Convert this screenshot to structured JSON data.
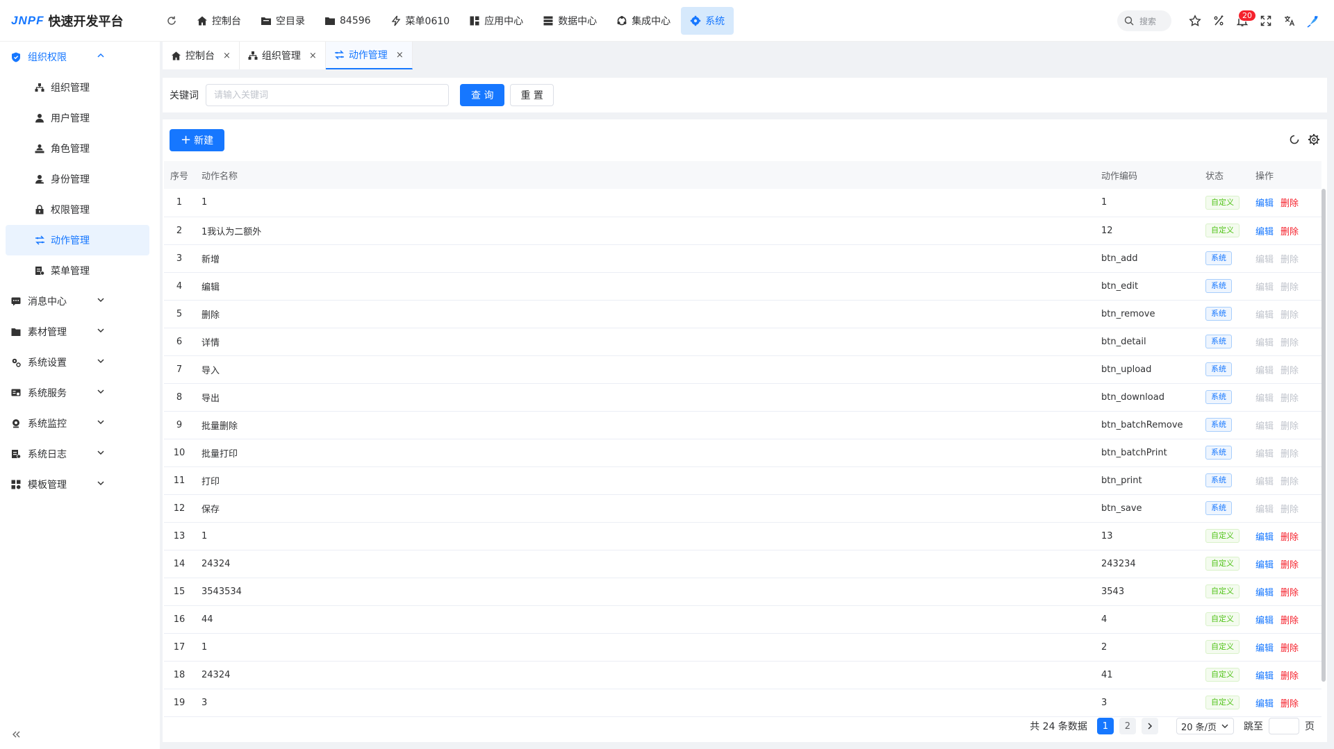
{
  "app": {
    "logo_mark": "JNPF",
    "title": "快速开发平台"
  },
  "topnav": [
    {
      "label": "控制台",
      "icon": "home-icon"
    },
    {
      "label": "空目录",
      "icon": "folder-icon"
    },
    {
      "label": "84596",
      "icon": "folder-icon"
    },
    {
      "label": "菜单0610",
      "icon": "lightning-icon"
    },
    {
      "label": "应用中心",
      "icon": "app-grid-icon"
    },
    {
      "label": "数据中心",
      "icon": "database-icon"
    },
    {
      "label": "集成中心",
      "icon": "integration-icon"
    },
    {
      "label": "系统",
      "icon": "gear-icon",
      "active": true
    }
  ],
  "header_right": {
    "search_label": "搜索",
    "notification_count": "20"
  },
  "sidebar": {
    "groups": [
      {
        "label": "组织权限",
        "open": true,
        "items": [
          {
            "label": "组织管理"
          },
          {
            "label": "用户管理"
          },
          {
            "label": "角色管理"
          },
          {
            "label": "身份管理"
          },
          {
            "label": "权限管理"
          },
          {
            "label": "动作管理",
            "active": true
          },
          {
            "label": "菜单管理"
          }
        ]
      },
      {
        "label": "消息中心"
      },
      {
        "label": "素材管理"
      },
      {
        "label": "系统设置"
      },
      {
        "label": "系统服务"
      },
      {
        "label": "系统监控"
      },
      {
        "label": "系统日志"
      },
      {
        "label": "模板管理"
      }
    ]
  },
  "tabs": [
    {
      "label": "控制台"
    },
    {
      "label": "组织管理"
    },
    {
      "label": "动作管理",
      "active": true
    }
  ],
  "search": {
    "keyword_label": "关键词",
    "placeholder": "请输入关键词",
    "query_label": "查 询",
    "reset_label": "重 置"
  },
  "toolbar": {
    "new_label": "新建"
  },
  "table": {
    "columns": [
      "序号",
      "动作名称",
      "动作编码",
      "状态",
      "操作"
    ],
    "edit_label": "编辑",
    "delete_label": "删除",
    "rows": [
      {
        "idx": "1",
        "name": "1",
        "code": "1",
        "status": "自定义",
        "type": "custom"
      },
      {
        "idx": "2",
        "name": "1我认为二额外",
        "code": "12",
        "status": "自定义",
        "type": "custom"
      },
      {
        "idx": "3",
        "name": "新增",
        "code": "btn_add",
        "status": "系统",
        "type": "system"
      },
      {
        "idx": "4",
        "name": "编辑",
        "code": "btn_edit",
        "status": "系统",
        "type": "system"
      },
      {
        "idx": "5",
        "name": "删除",
        "code": "btn_remove",
        "status": "系统",
        "type": "system"
      },
      {
        "idx": "6",
        "name": "详情",
        "code": "btn_detail",
        "status": "系统",
        "type": "system"
      },
      {
        "idx": "7",
        "name": "导入",
        "code": "btn_upload",
        "status": "系统",
        "type": "system"
      },
      {
        "idx": "8",
        "name": "导出",
        "code": "btn_download",
        "status": "系统",
        "type": "system"
      },
      {
        "idx": "9",
        "name": "批量删除",
        "code": "btn_batchRemove",
        "status": "系统",
        "type": "system"
      },
      {
        "idx": "10",
        "name": "批量打印",
        "code": "btn_batchPrint",
        "status": "系统",
        "type": "system"
      },
      {
        "idx": "11",
        "name": "打印",
        "code": "btn_print",
        "status": "系统",
        "type": "system"
      },
      {
        "idx": "12",
        "name": "保存",
        "code": "btn_save",
        "status": "系统",
        "type": "system"
      },
      {
        "idx": "13",
        "name": "1",
        "code": "13",
        "status": "自定义",
        "type": "custom"
      },
      {
        "idx": "14",
        "name": "24324",
        "code": "243234",
        "status": "自定义",
        "type": "custom"
      },
      {
        "idx": "15",
        "name": "3543534",
        "code": "3543",
        "status": "自定义",
        "type": "custom"
      },
      {
        "idx": "16",
        "name": "44",
        "code": "4",
        "status": "自定义",
        "type": "custom"
      },
      {
        "idx": "17",
        "name": "1",
        "code": "2",
        "status": "自定义",
        "type": "custom"
      },
      {
        "idx": "18",
        "name": "24324",
        "code": "41",
        "status": "自定义",
        "type": "custom"
      },
      {
        "idx": "19",
        "name": "3",
        "code": "3",
        "status": "自定义",
        "type": "custom"
      }
    ]
  },
  "pagination": {
    "total_text": "共 24 条数据",
    "pages": [
      "1",
      "2"
    ],
    "current": "1",
    "page_size": "20 条/页",
    "jump_label": "跳至",
    "page_suffix": "页"
  },
  "colors": {
    "primary": "#1677ff",
    "danger": "#f5222d",
    "success": "#52c41a"
  }
}
